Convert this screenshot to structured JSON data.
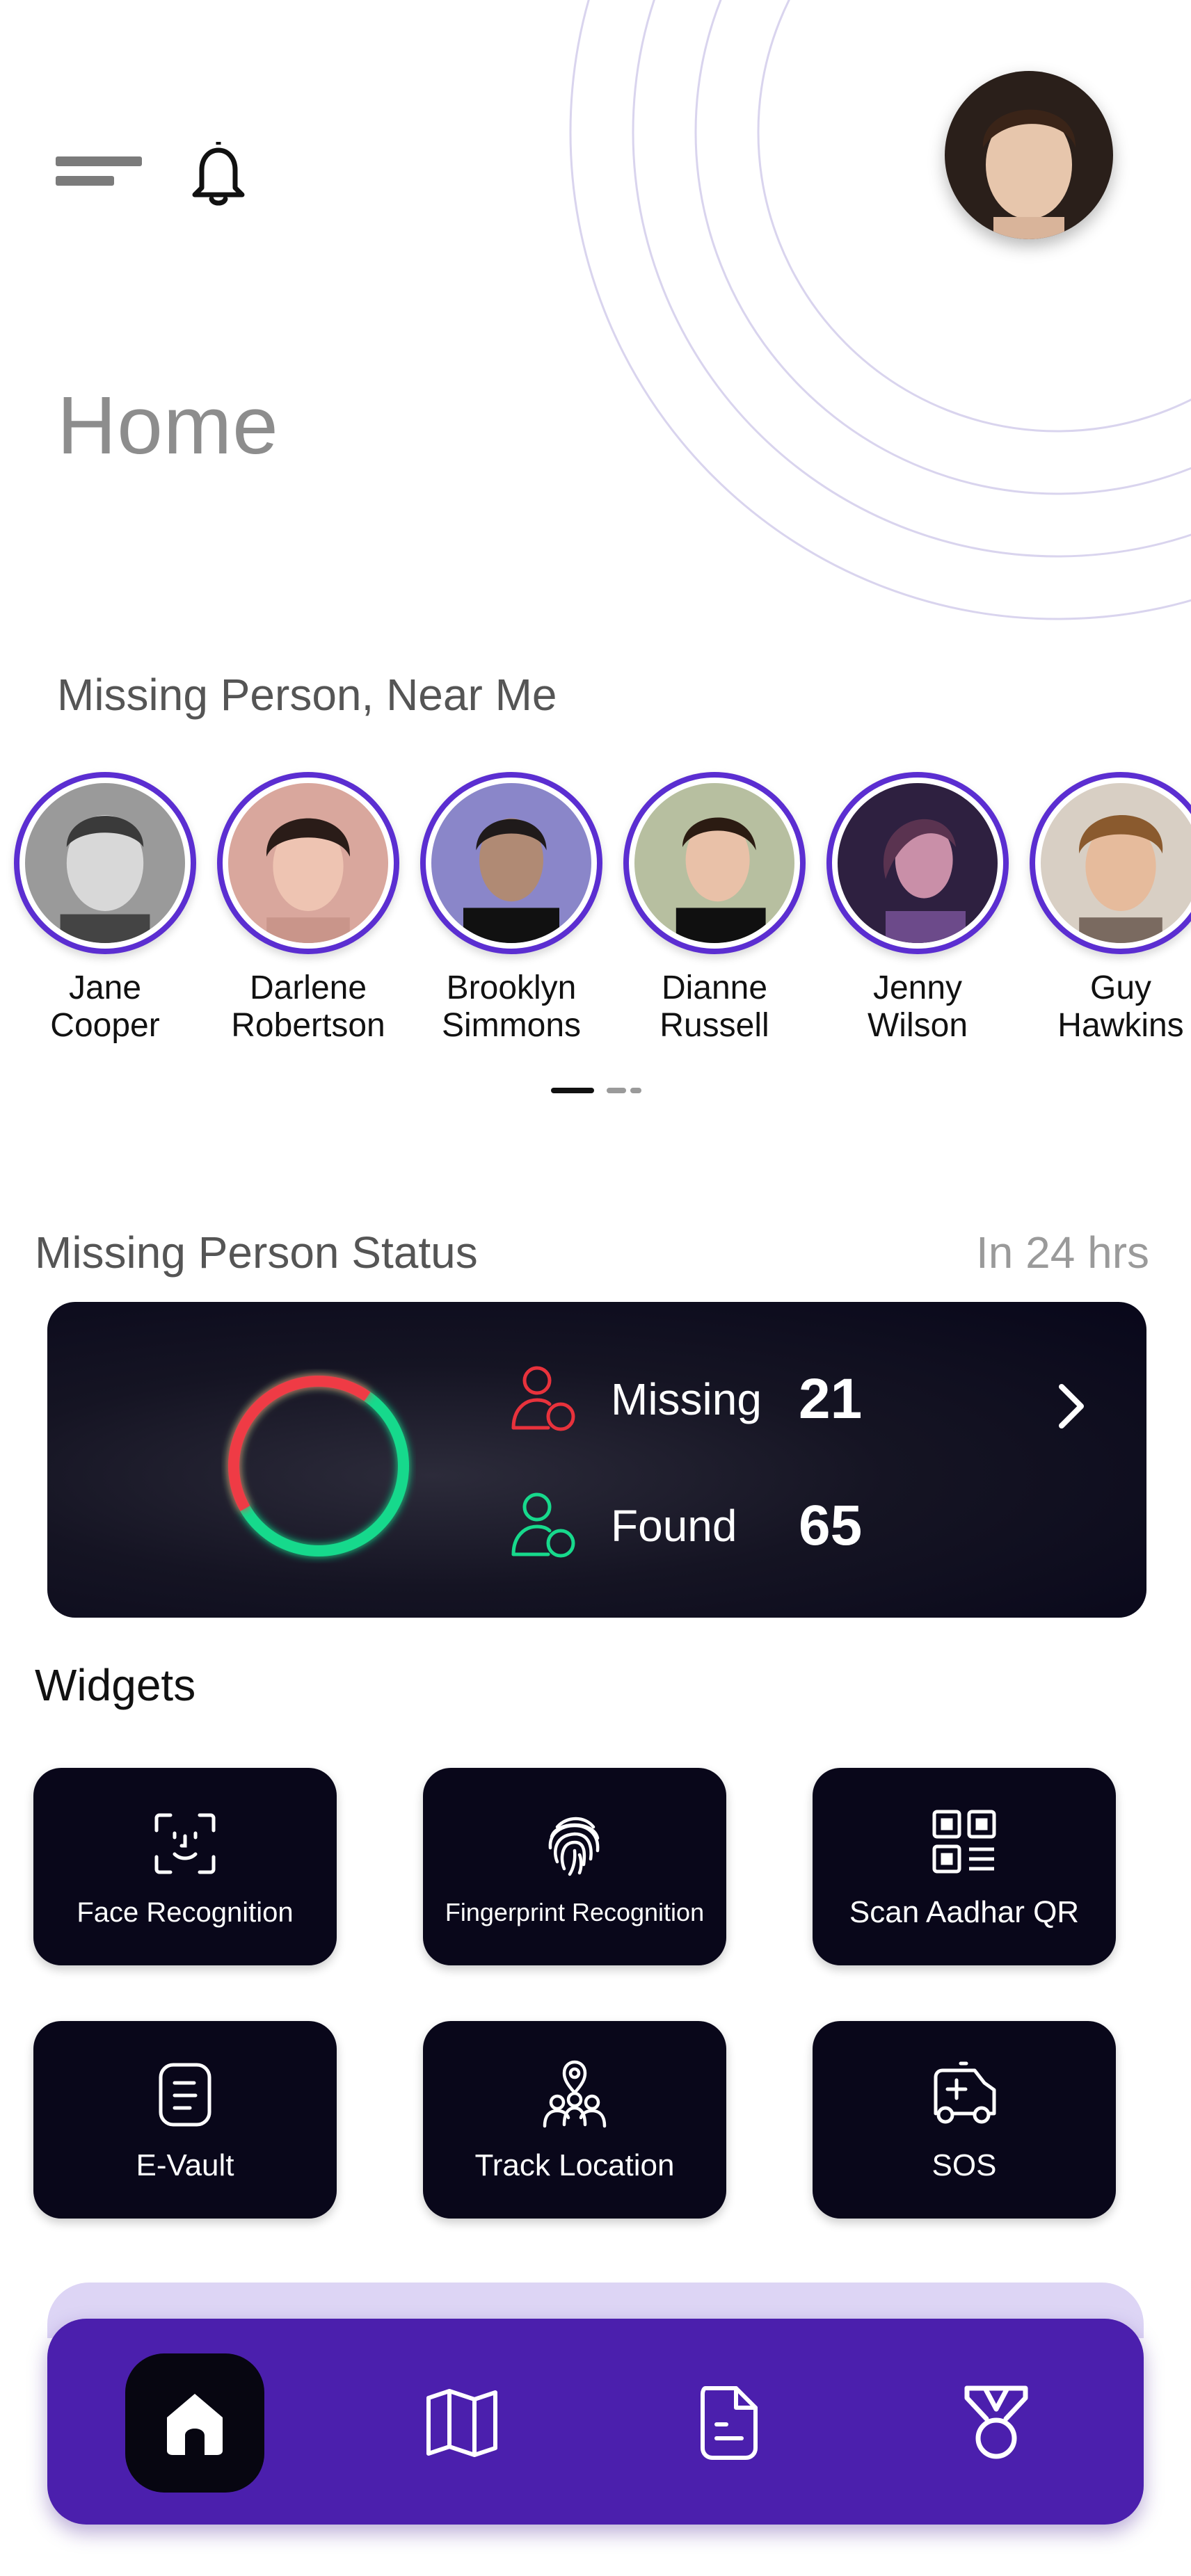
{
  "header": {
    "title": "Home",
    "menu_icon": "menu-icon",
    "notification_icon": "bell-icon",
    "profile_avatar": "profile-avatar"
  },
  "missing_near": {
    "title": "Missing Person, Near Me",
    "people": [
      {
        "first": "Jane",
        "last": "Cooper"
      },
      {
        "first": "Darlene",
        "last": "Robertson"
      },
      {
        "first": "Brooklyn",
        "last": "Simmons"
      },
      {
        "first": "Dianne",
        "last": "Russell"
      },
      {
        "first": "Jenny",
        "last": "Wilson"
      },
      {
        "first": "Guy",
        "last": "Hawkins"
      }
    ],
    "pager": {
      "pages": 2,
      "active": 1
    }
  },
  "status": {
    "title": "Missing Person Status",
    "timeframe": "In 24 hrs",
    "missing_label": "Missing",
    "missing_count": "21",
    "found_label": "Found",
    "found_count": "65"
  },
  "widgets": {
    "title": "Widgets",
    "items": [
      {
        "label": "Face Recognition",
        "icon": "face-scan-icon"
      },
      {
        "label": "Fingerprint Recognition",
        "icon": "fingerprint-icon"
      },
      {
        "label": "Scan Aadhar QR",
        "icon": "qr-code-icon"
      },
      {
        "label": "E-Vault",
        "icon": "document-icon"
      },
      {
        "label": "Track Location",
        "icon": "location-people-icon"
      },
      {
        "label": "SOS",
        "icon": "ambulance-icon"
      }
    ]
  },
  "nav": {
    "items": [
      "home-icon",
      "map-icon",
      "file-icon",
      "medal-icon"
    ],
    "active": "home-icon"
  },
  "colors": {
    "accent_purple": "#4b1fad",
    "avatar_ring": "#5b2ed1",
    "missing_red": "#e8323c",
    "found_green": "#17d98c",
    "card_dark": "#09071a"
  }
}
